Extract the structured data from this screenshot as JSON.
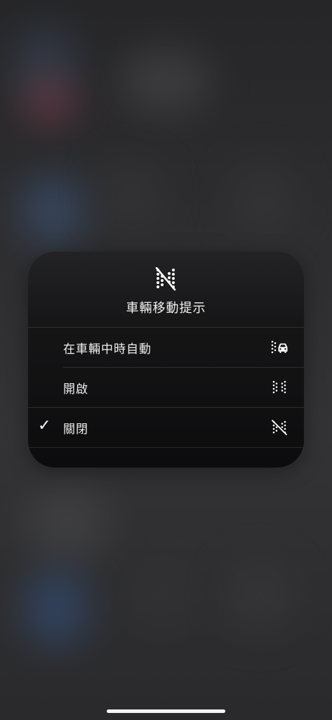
{
  "menu": {
    "title": "車輛移動提示",
    "header_icon": "vehicle-motion-cues-off-icon",
    "options": [
      {
        "label": "在車輛中時自動",
        "icon": "dots-with-car-icon",
        "selected": false
      },
      {
        "label": "開啟",
        "icon": "dots-icon",
        "selected": false
      },
      {
        "label": "關閉",
        "icon": "dots-slashed-icon",
        "selected": true
      }
    ],
    "checkmark": "✓"
  },
  "colors": {
    "menu_background": "#151516",
    "text": "#f0f0f0",
    "home_indicator": "#f5f5f5"
  }
}
